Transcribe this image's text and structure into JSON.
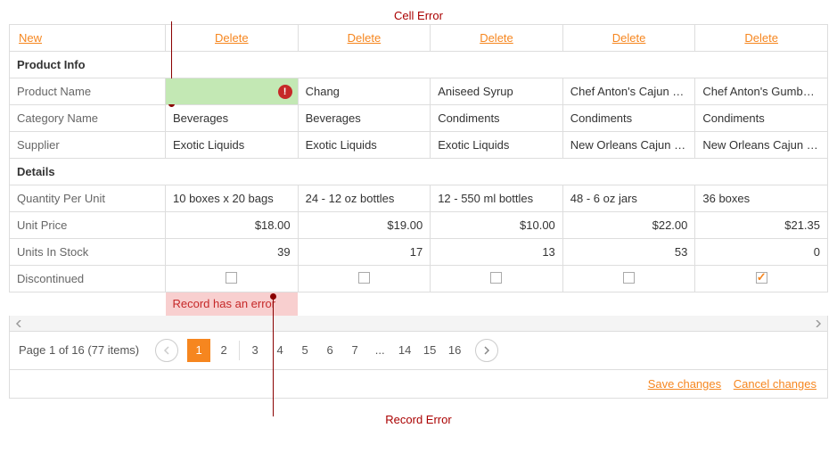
{
  "callouts": {
    "cell_error": "Cell Error",
    "record_error": "Record Error"
  },
  "commands": {
    "new": "New",
    "delete": "Delete"
  },
  "groups": {
    "product_info": "Product Info",
    "details": "Details"
  },
  "rows": {
    "product_name": "Product Name",
    "category_name": "Category Name",
    "supplier": "Supplier",
    "qty_per_unit": "Quantity Per Unit",
    "unit_price": "Unit Price",
    "units_in_stock": "Units In Stock",
    "discontinued": "Discontinued"
  },
  "cols": [
    {
      "product_name": "",
      "category": "Beverages",
      "supplier": "Exotic Liquids",
      "qty": "10 boxes x 20 bags",
      "price": "$18.00",
      "stock": "39",
      "disc": false,
      "error": "Record has an error",
      "cell_error": true
    },
    {
      "product_name": "Chang",
      "category": "Beverages",
      "supplier": "Exotic Liquids",
      "qty": "24 - 12 oz bottles",
      "price": "$19.00",
      "stock": "17",
      "disc": false
    },
    {
      "product_name": "Aniseed Syrup",
      "category": "Condiments",
      "supplier": "Exotic Liquids",
      "qty": "12 - 550 ml bottles",
      "price": "$10.00",
      "stock": "13",
      "disc": false
    },
    {
      "product_name": "Chef Anton's Cajun Sea...",
      "category": "Condiments",
      "supplier": "New Orleans Cajun Deli...",
      "qty": "48 - 6 oz jars",
      "price": "$22.00",
      "stock": "53",
      "disc": false
    },
    {
      "product_name": "Chef Anton's Gumbo Mix",
      "category": "Condiments",
      "supplier": "New Orleans Cajun Deli...",
      "qty": "36 boxes",
      "price": "$21.35",
      "stock": "0",
      "disc": true
    }
  ],
  "pager": {
    "info": "Page 1 of 16 (77 items)",
    "pages": [
      "1",
      "2",
      "3",
      "4",
      "5",
      "6",
      "7",
      "...",
      "14",
      "15",
      "16"
    ],
    "current": "1"
  },
  "toolbar": {
    "save": "Save changes",
    "cancel": "Cancel changes"
  }
}
